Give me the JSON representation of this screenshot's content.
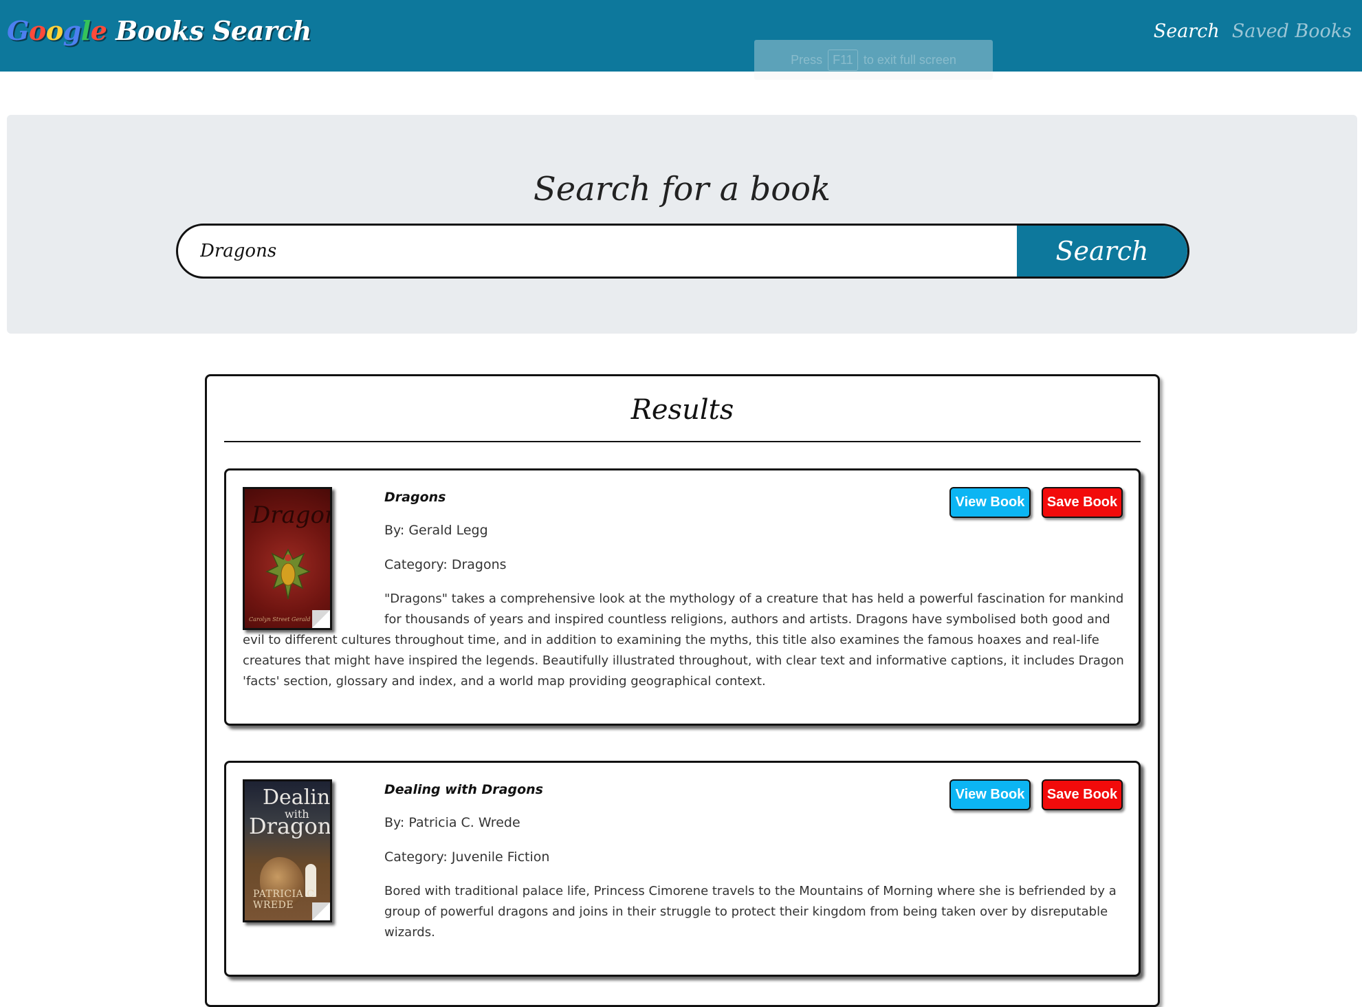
{
  "navbar": {
    "brand_google": [
      "G",
      "o",
      "o",
      "g",
      "l",
      "e"
    ],
    "brand_rest": "Books Search",
    "links": {
      "search": "Search",
      "saved": "Saved Books"
    },
    "fullscreen_hint": {
      "press": "Press",
      "key": "F11",
      "rest": "to exit full screen"
    }
  },
  "jumbotron": {
    "title": "Search for a book",
    "input_value": "Dragons",
    "button_label": "Search"
  },
  "results": {
    "title": "Results",
    "books": [
      {
        "title": "Dragons",
        "author": "By: Gerald Legg",
        "category": "Category: Dragons",
        "description": "\"Dragons\" takes a comprehensive look at the mythology of a creature that has held a powerful fascination for mankind for thousands of years and inspired countless religions, authors and artists. Dragons have symbolised both good and evil to different cultures throughout time, and in addition to examining the myths, this title also examines the famous hoaxes and real-life creatures that might have inspired the legends. Beautifully illustrated throughout, with clear text and informative captions, it includes Dragon 'facts' section, glossary and index, and a world map providing geographical context.",
        "cover_text": {
          "title": "Dragons",
          "foot": "Carolyn Street     Gerald Legg"
        },
        "view_label": "View Book",
        "save_label": "Save Book"
      },
      {
        "title": "Dealing with Dragons",
        "author": "By: Patricia C. Wrede",
        "category": "Category: Juvenile Fiction",
        "description": "Bored with traditional palace life, Princess Cimorene travels to the Mountains of Morning where she is befriended by a group of powerful dragons and joins in their struggle to protect their kingdom from being taken over by disreputable wizards.",
        "cover_text": {
          "dealing": "Dealing",
          "with": "with",
          "dragons": "Dragons",
          "author": "PATRICIA C. WREDE"
        },
        "view_label": "View Book",
        "save_label": "Save Book"
      }
    ]
  },
  "colors": {
    "navbar": "#0d789c",
    "jumbotron": "#e9ecef",
    "view_button": "#0cb5f3",
    "save_button": "#f20b0b"
  }
}
